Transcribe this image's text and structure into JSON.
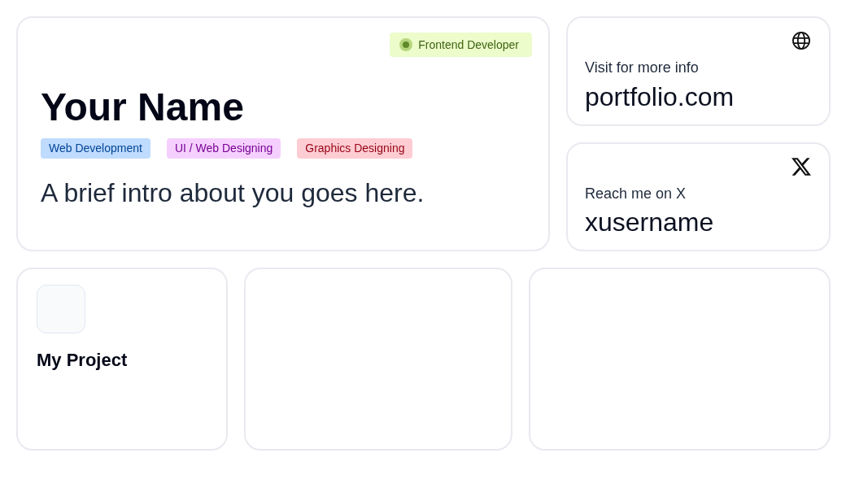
{
  "profile": {
    "badge": {
      "label": "Frontend Developer"
    },
    "name": "Your Name",
    "tags": [
      {
        "label": "Web Development",
        "color": "#bfdbfe"
      },
      {
        "label": "UI / Web Designing",
        "color": "#f5d0fe"
      },
      {
        "label": "Graphics Designing",
        "color": "#fecdd3"
      }
    ],
    "intro": "A brief intro about you goes here."
  },
  "links": [
    {
      "kind": "web",
      "caption": "Visit for more info",
      "value": "portfolio.com"
    },
    {
      "kind": "x",
      "caption": "Reach me on X",
      "value": "xusername"
    }
  ],
  "projects": [
    {
      "kind": "project",
      "title": "My Project"
    },
    {
      "kind": "empty"
    },
    {
      "kind": "empty"
    }
  ]
}
